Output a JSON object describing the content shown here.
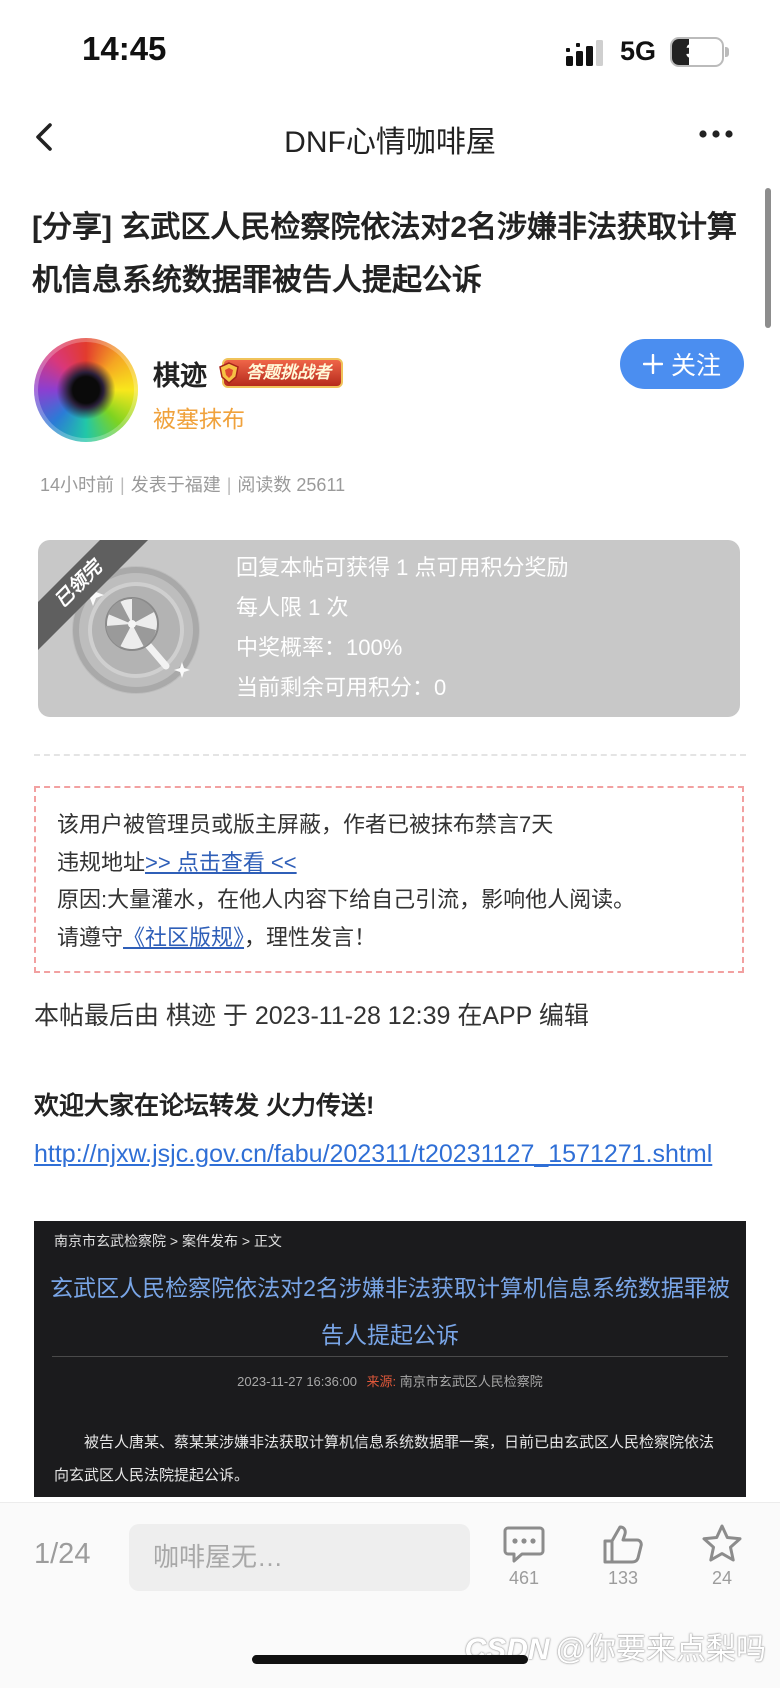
{
  "status_bar": {
    "time": "14:45",
    "network": "5G",
    "battery": "33",
    "battery_level": 0.33
  },
  "nav": {
    "title": "DNF心情咖啡屋"
  },
  "post": {
    "title": "[分享] 玄武区人民检察院依法对2名涉嫌非法获取计算机信息系统数据罪被告人提起公诉"
  },
  "author": {
    "name": "棋迹",
    "badge": "答题挑战者",
    "subtitle": "被塞抹布",
    "follow_label": "关注"
  },
  "meta": {
    "time": "14小时前",
    "location": "发表于福建",
    "reads": "阅读数 25611",
    "separator": "|"
  },
  "reward": {
    "ribbon": "已领完",
    "lines": [
      "回复本帖可获得 1 点可用积分奖励",
      "每人限 1 次",
      "中奖概率：100%",
      "当前剩余可用积分：0"
    ]
  },
  "notice": {
    "line1": "该用户被管理员或版主屏蔽，作者已被抹布禁言7天",
    "line2_prefix": "违规地址",
    "line2_link": ">> 点击查看 <<",
    "line3": "原因:大量灌水，在他人内容下给自己引流，影响他人阅读。",
    "line4_prefix": "请遵守",
    "line4_link": "《社区版规》",
    "line4_suffix": "，理性发言！"
  },
  "content": {
    "edit_note": "本帖最后由 棋迹 于 2023-11-28 12:39 在APP 编辑",
    "bold_line": "欢迎大家在论坛转发 火力传送!",
    "link": "http://njxw.jsjc.gov.cn/fabu/202311/t20231127_1571271.shtml"
  },
  "embedded_shot": {
    "breadcrumb": "南京市玄武检察院 > 案件发布 > 正文",
    "headline": "玄武区人民检察院依法对2名涉嫌非法获取计算机信息系统数据罪被告人提起公诉",
    "date": "2023-11-27 16:36:00",
    "source_label": "来源:",
    "source": "南京市玄武区人民检察院",
    "body": "被告人唐某、蔡某某涉嫌非法获取计算机信息系统数据罪一案，日前已由玄武区人民检察院依法向玄武区人民法院提起公诉。"
  },
  "bottom_bar": {
    "page": "1/24",
    "reply_placeholder": "咖啡屋无…",
    "comments": "461",
    "likes": "133",
    "favorites": "24"
  },
  "watermark": {
    "logo": "CSDN",
    "text": "@你要来点梨吗"
  },
  "colors": {
    "accent_blue": "#4b8ef0",
    "link_blue": "#2f6fd6",
    "orange": "#f0a23c",
    "notice_border": "#f2a0a0"
  }
}
